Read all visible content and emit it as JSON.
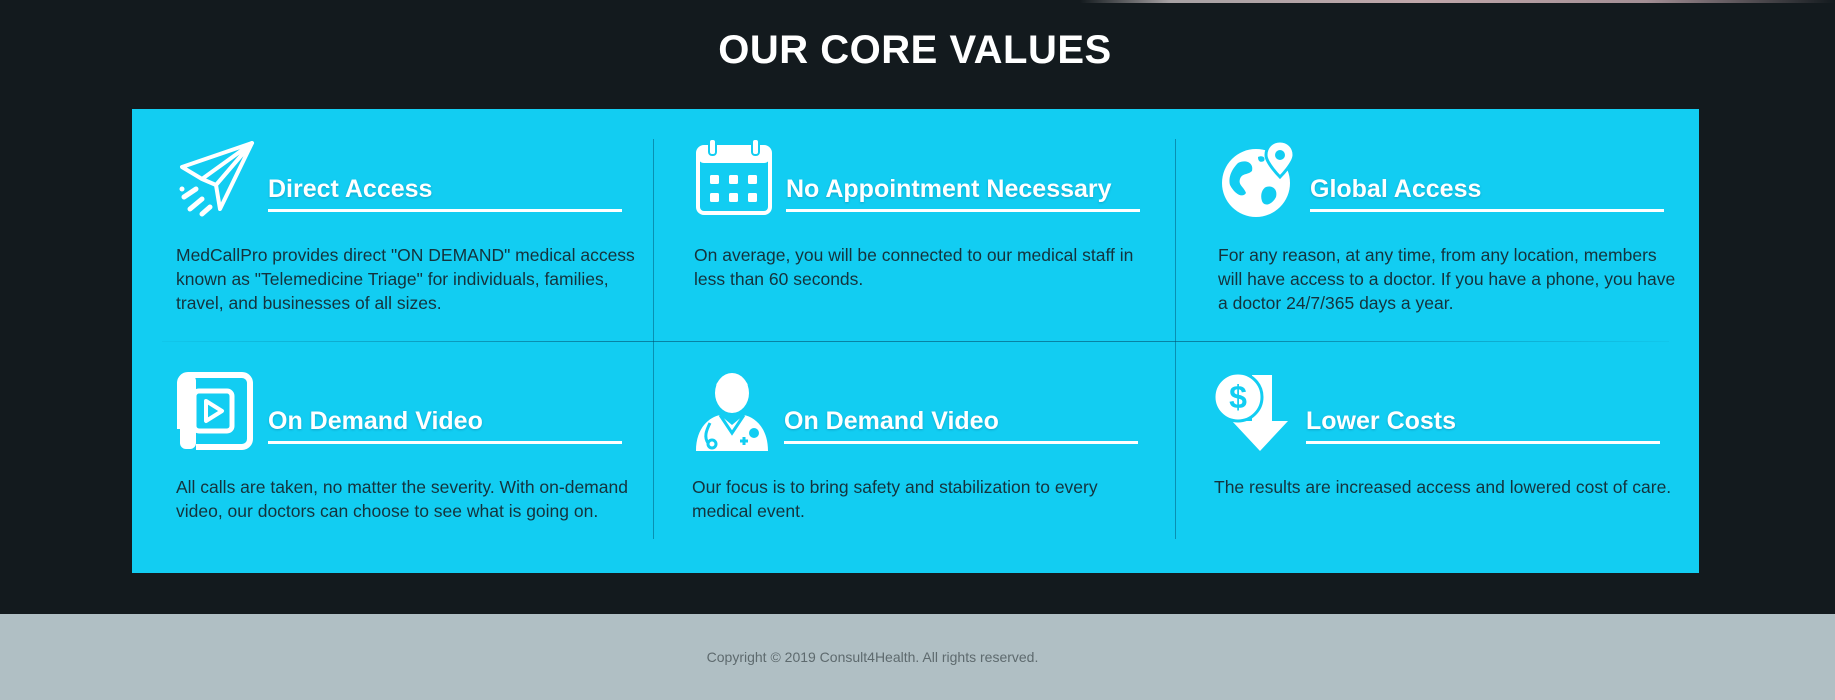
{
  "section": {
    "title": "OUR CORE VALUES"
  },
  "values": [
    {
      "title": "Direct Access",
      "icon": "paper-plane-icon",
      "description": "MedCallPro provides direct \"ON DEMAND\" medical access known as \"Telemedicine Triage\" for individuals, families, travel, and businesses of all sizes."
    },
    {
      "title": "No Appointment Necessary",
      "icon": "calendar-icon",
      "description": "On average, you will be connected to our medical staff in less than 60 seconds."
    },
    {
      "title": "Global Access",
      "icon": "globe-location-icon",
      "description": "For any reason, at any time, from any location, members will have access to a doctor. If you have a phone, you have a doctor 24/7/365 days a year."
    },
    {
      "title": "On Demand Video",
      "icon": "video-play-icon",
      "description": "All calls are taken, no matter the severity.  With on-demand video, our doctors can choose to see what is going on."
    },
    {
      "title": "On Demand Video",
      "icon": "doctor-icon",
      "description": "Our focus is to bring safety and stabilization to every medical event."
    },
    {
      "title": "Lower Costs",
      "icon": "dollar-down-arrow-icon",
      "description": "The results are increased access and lowered cost of care."
    }
  ],
  "footer": {
    "copyright": "Copyright © 2019 Consult4Health. All rights reserved."
  },
  "colors": {
    "page_background": "#131a1e",
    "panel_background": "#12cdf2",
    "heading_text": "#ffffff",
    "body_text": "#14333d",
    "footer_background": "#b0bfc4",
    "footer_text": "#5e6a6e"
  }
}
